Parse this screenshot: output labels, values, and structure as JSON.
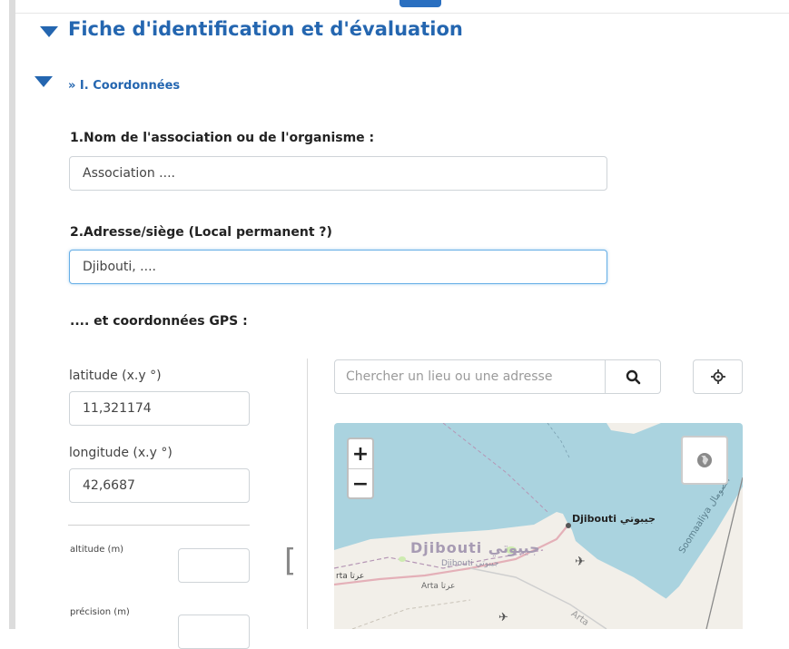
{
  "sections": {
    "main_title": "Fiche d'identification et d'évaluation",
    "sub_title": "» I. Coordonnées"
  },
  "form": {
    "q1_label": "1.Nom de l'association ou de l'organisme :",
    "q1_value": "Association ....",
    "q2_label": "2.Adresse/siège (Local permanent ?)",
    "q2_value": "Djibouti, ....",
    "gps_label": ".... et coordonnées GPS :"
  },
  "gps": {
    "latitude_label": "latitude (x.y °)",
    "latitude_value": "11,321174",
    "longitude_label": "longitude (x.y °)",
    "longitude_value": "42,6687",
    "altitude_label": "altitude (m)",
    "altitude_value": "",
    "precision_label": "précision (m)",
    "precision_value": ""
  },
  "map": {
    "search_placeholder": "Chercher un lieu ou une adresse",
    "search_icon": "search-icon",
    "locate_icon": "crosshair-icon",
    "zoom_in": "+",
    "zoom_out": "−",
    "layers_icon": "globe-icon",
    "labels": {
      "city": "Djibouti",
      "city_ar": "جيبوتي",
      "country": "Djibouti",
      "country_ar": "جيبوتي",
      "region": "Djibouti",
      "region_ar": "جيبوتي",
      "arta": "Arta",
      "arta_ar": "عرتا",
      "arta_short": "rta",
      "somalia": "Soomaaliya",
      "somalia_ar": "الصومال",
      "arta_corner": "Arta"
    },
    "colors": {
      "water": "#aad3df",
      "land": "#f2efe9",
      "title_blue": "#2466b0"
    }
  }
}
